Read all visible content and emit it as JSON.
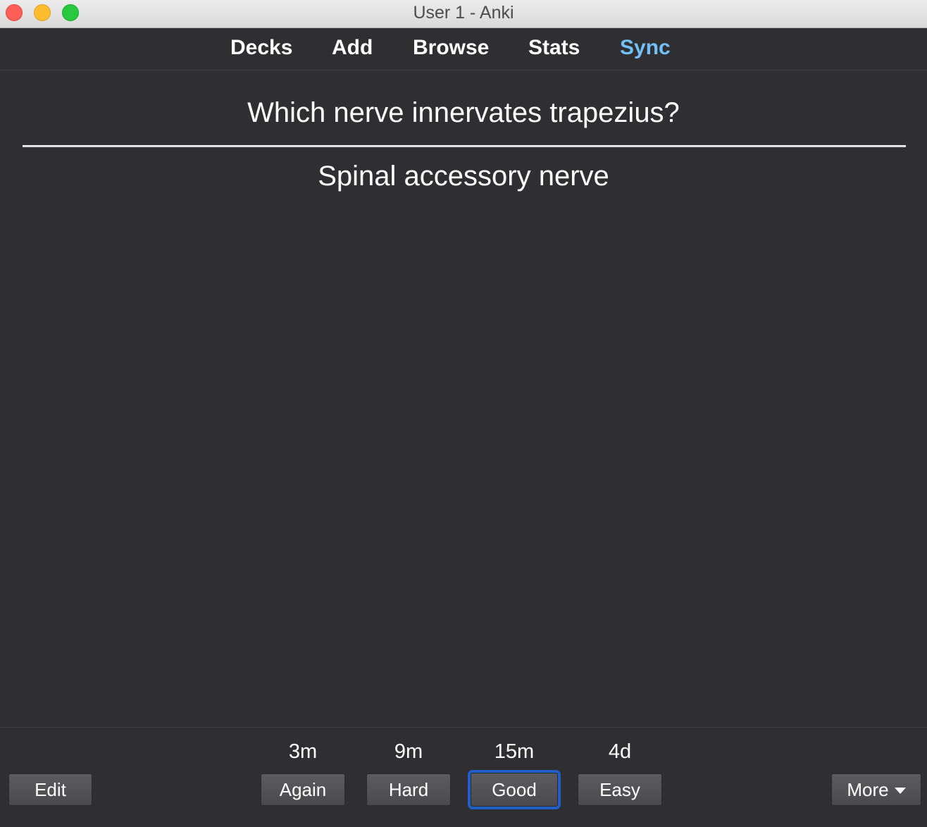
{
  "window": {
    "title": "User 1 - Anki"
  },
  "nav": {
    "decks": "Decks",
    "add": "Add",
    "browse": "Browse",
    "stats": "Stats",
    "sync": "Sync",
    "sync_color": "#72c0f7"
  },
  "card": {
    "question": "Which nerve innervates trapezius?",
    "answer": "Spinal accessory nerve"
  },
  "answer_buttons": [
    {
      "interval": "3m",
      "label": "Again"
    },
    {
      "interval": "9m",
      "label": "Hard"
    },
    {
      "interval": "15m",
      "label": "Good",
      "focused": true
    },
    {
      "interval": "4d",
      "label": "Easy"
    }
  ],
  "bottom": {
    "edit_label": "Edit",
    "more_label": "More",
    "more_icon": "chevron-down-icon"
  },
  "colors": {
    "background": "#2f2f31",
    "focus_ring": "#1f5fc7"
  }
}
